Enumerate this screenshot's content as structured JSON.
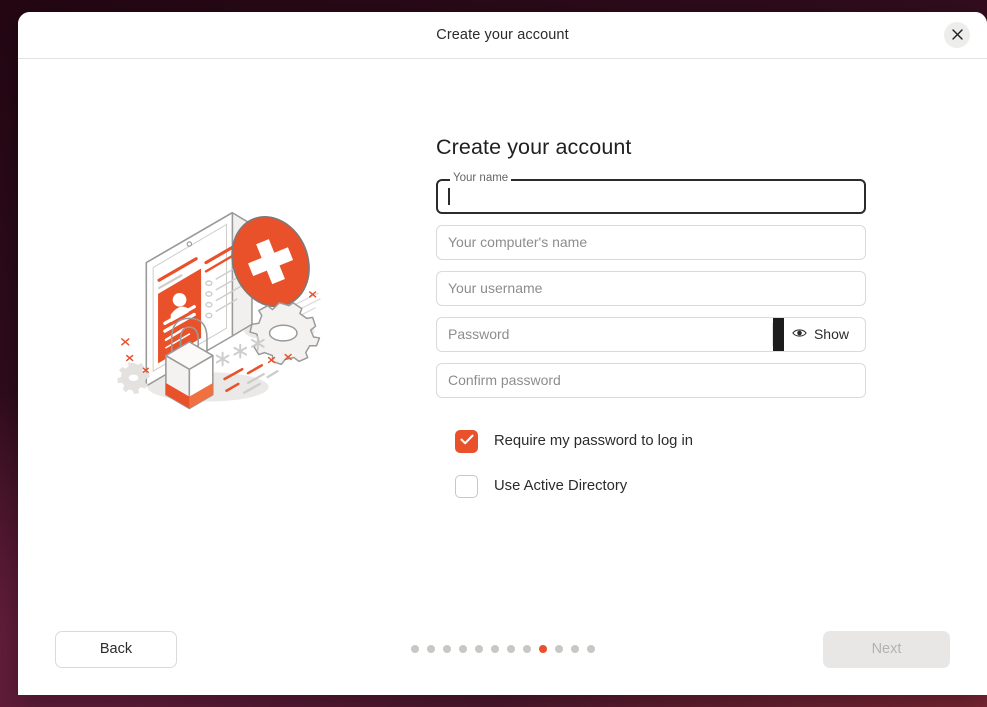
{
  "window": {
    "title": "Create your account",
    "close_icon": "close-icon"
  },
  "content": {
    "heading": "Create your account",
    "illustration_alt": "account-setup-illustration"
  },
  "form": {
    "fields": [
      {
        "name": "full-name",
        "label": "Your name",
        "placeholder": "",
        "value": "",
        "focused": true,
        "type": "text"
      },
      {
        "name": "computer-name",
        "label": "",
        "placeholder": "Your computer's name",
        "value": "",
        "focused": false,
        "type": "text"
      },
      {
        "name": "username",
        "label": "",
        "placeholder": "Your username",
        "value": "",
        "focused": false,
        "type": "text"
      },
      {
        "name": "password",
        "label": "",
        "placeholder": "Password",
        "value": "",
        "focused": false,
        "type": "password",
        "action_label": "Show",
        "action_icon": "eye-icon"
      },
      {
        "name": "confirm-password",
        "label": "",
        "placeholder": "Confirm password",
        "value": "",
        "focused": false,
        "type": "password"
      }
    ],
    "checkboxes": [
      {
        "name": "require-password",
        "label": "Require my password to log in",
        "checked": true
      },
      {
        "name": "use-active-directory",
        "label": "Use Active Directory",
        "checked": false
      }
    ]
  },
  "footer": {
    "back_label": "Back",
    "next_label": "Next",
    "next_enabled": false,
    "pagination": {
      "total": 12,
      "current": 9
    }
  },
  "colors": {
    "accent": "#e8512a",
    "desktop": "#3a0f22",
    "disabled_button_bg": "#e9e7e5",
    "disabled_button_text": "#b4b2b0",
    "field_border": "#dcdad7",
    "focused_border": "#2b2b2b"
  }
}
